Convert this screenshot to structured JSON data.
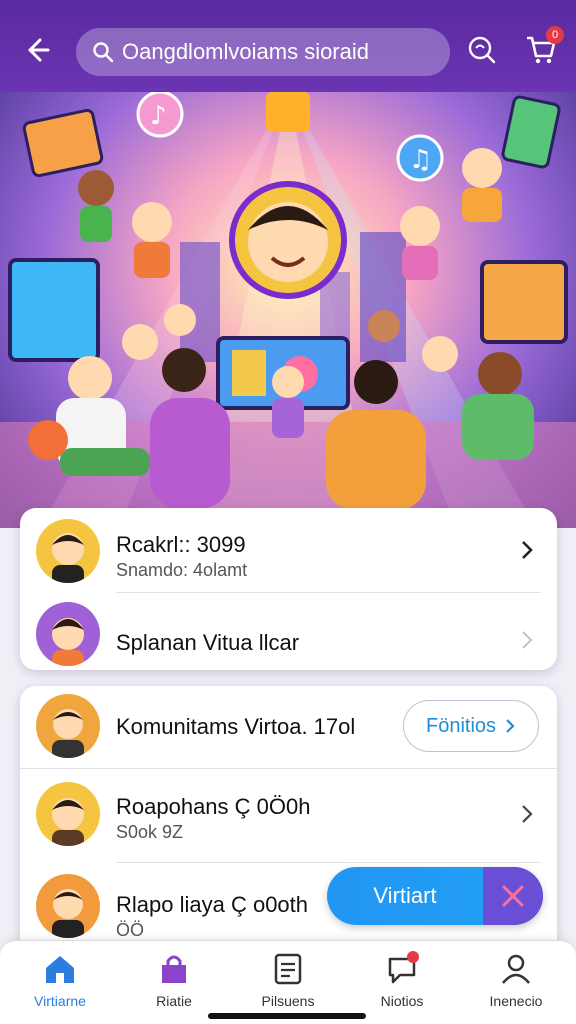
{
  "header": {
    "search_text": "Oangdlomlvoiams sioraid",
    "cart_badge": "0"
  },
  "card1": [
    {
      "title": "Rcakrl:: 3099",
      "subtitle": "Snamdo: 4olamt"
    },
    {
      "title": "Splanan Vitua llcar",
      "subtitle": ""
    }
  ],
  "card2": [
    {
      "title": "Komunitams Virtoa. 17ol",
      "subtitle": "",
      "button": "Fönitios"
    },
    {
      "title": "Roapohans Ç 0Ö0h",
      "subtitle": "S0ok 9Z"
    },
    {
      "title": "Rlapo liaya Ç o0oth",
      "subtitle": "ÖÖ"
    }
  ],
  "fab": {
    "label": "Virtiart"
  },
  "nav": [
    {
      "label": "Virtiarne",
      "icon": "home-icon",
      "active": true
    },
    {
      "label": "Riatie",
      "icon": "bag-icon"
    },
    {
      "label": "Pilsuens",
      "icon": "notes-icon"
    },
    {
      "label": "Niotios",
      "icon": "chat-icon",
      "badge": "1"
    },
    {
      "label": "Inenecio",
      "icon": "profile-icon"
    }
  ],
  "colors": {
    "header": "#5a2aa0",
    "accent": "#2196f3",
    "active_nav": "#2b7de0",
    "fab_close": "#6a4fd6"
  }
}
